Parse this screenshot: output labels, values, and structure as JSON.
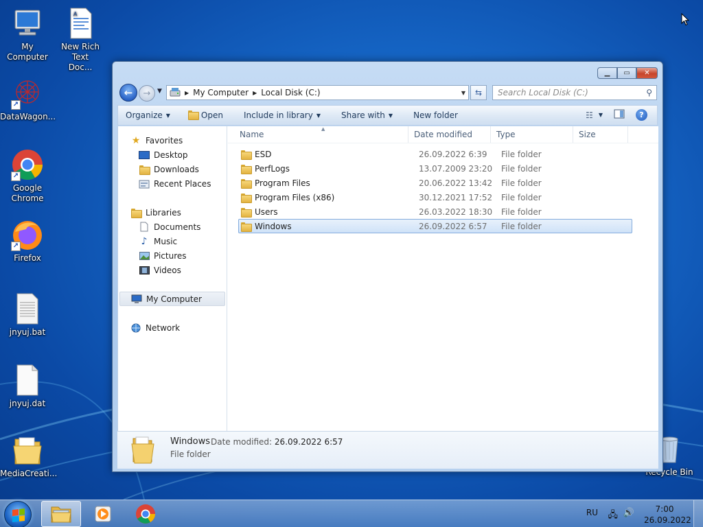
{
  "desktop": {
    "icons": [
      {
        "label": "My Computer",
        "icon": "computer-icon"
      },
      {
        "label": "New Rich Text Doc...",
        "icon": "rtf-document-icon"
      },
      {
        "label": "DataWagon...",
        "icon": "datawagon-icon"
      },
      {
        "label": "Google Chrome",
        "icon": "chrome-icon"
      },
      {
        "label": "Firefox",
        "icon": "firefox-icon"
      },
      {
        "label": "jnyuj.bat",
        "icon": "bat-file-icon"
      },
      {
        "label": "jnyuj.dat",
        "icon": "dat-file-icon"
      },
      {
        "label": "MediaCreati...",
        "icon": "folder-icon"
      },
      {
        "label": "Recycle Bin",
        "icon": "recycle-bin-icon"
      }
    ]
  },
  "explorer": {
    "address": {
      "segments": [
        "My Computer",
        "Local Disk (C:)"
      ]
    },
    "search_placeholder": "Search Local Disk (C:)",
    "toolbar": {
      "organize": "Organize",
      "open": "Open",
      "include": "Include in library",
      "share": "Share with",
      "new_folder": "New folder"
    },
    "nav": {
      "favorites": "Favorites",
      "desktop": "Desktop",
      "downloads": "Downloads",
      "recent": "Recent Places",
      "libraries": "Libraries",
      "documents": "Documents",
      "music": "Music",
      "pictures": "Pictures",
      "videos": "Videos",
      "my_computer": "My Computer",
      "network": "Network"
    },
    "columns": {
      "name": "Name",
      "date": "Date modified",
      "type": "Type",
      "size": "Size"
    },
    "files": [
      {
        "name": "ESD",
        "date": "26.09.2022 6:39",
        "type": "File folder"
      },
      {
        "name": "PerfLogs",
        "date": "13.07.2009 23:20",
        "type": "File folder"
      },
      {
        "name": "Program Files",
        "date": "20.06.2022 13:42",
        "type": "File folder"
      },
      {
        "name": "Program Files (x86)",
        "date": "30.12.2021 17:52",
        "type": "File folder"
      },
      {
        "name": "Users",
        "date": "26.03.2022 18:30",
        "type": "File folder"
      },
      {
        "name": "Windows",
        "date": "26.09.2022 6:57",
        "type": "File folder"
      }
    ],
    "selected_file": "Windows",
    "details": {
      "name": "Windows",
      "date_label": "Date modified:",
      "date_value": "26.09.2022 6:57",
      "type": "File folder"
    }
  },
  "taskbar": {
    "lang": "RU",
    "time": "7:00",
    "date": "26.09.2022"
  }
}
